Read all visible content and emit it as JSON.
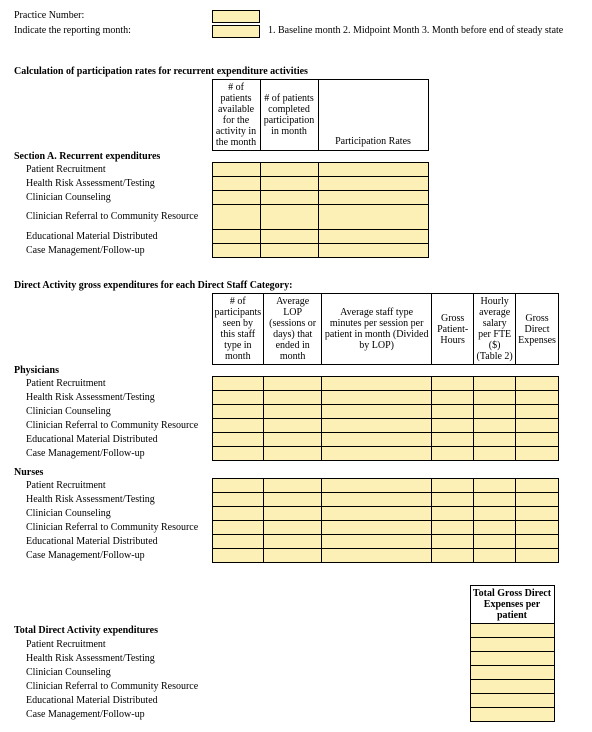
{
  "top": {
    "practice_number": "Practice Number:",
    "indicate_month": "Indicate the reporting month:",
    "month_legend": "1. Baseline month 2. Midpoint Month 3. Month before end of steady state"
  },
  "sectionA": {
    "title": "Calculation of participation rates for recurrent expenditure activities",
    "header1": "# of patients available for the activity in the month",
    "header2": "# of patients completed participation in month",
    "header3": "Participation Rates",
    "section_label": "Section A. Recurrent expenditures",
    "rows": [
      "Patient Recruitment",
      "Health Risk Assessment/Testing",
      "Clinician Counseling",
      "Clinician Referral to Community Resource",
      "Educational Material Distributed",
      "Case Management/Follow-up"
    ]
  },
  "direct": {
    "title": "Direct Activity gross expenditures for each Direct Staff Category:",
    "h1": "# of participants seen by this staff type in month",
    "h2": "Average LOP (sessions or days) that ended in month",
    "h3": "Average staff type minutes per session per patient in month (Divided by LOP)",
    "h4": "Gross Patient-Hours",
    "h5": "Hourly average salary per FTE ($) (Table 2)",
    "h6": "Gross Direct Expenses",
    "physicians": "Physicians",
    "nurses": "Nurses",
    "rows": [
      "Patient Recruitment",
      "Health Risk Assessment/Testing",
      "Clinician Counseling",
      "Clinician Referral to Community Resource",
      "Educational Material Distributed",
      "Case Management/Follow-up"
    ]
  },
  "total": {
    "title": "Total Direct Activity expenditures",
    "header": "Total Gross Direct Expenses per patient",
    "rows": [
      "Patient Recruitment",
      "Health Risk Assessment/Testing",
      "Clinician Counseling",
      "Clinician Referral to Community Resource",
      "Educational Material Distributed",
      "Case Management/Follow-up"
    ]
  }
}
